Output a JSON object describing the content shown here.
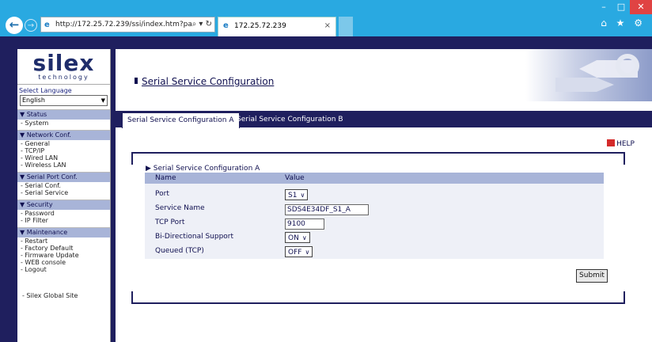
{
  "browser": {
    "url": "http://172.25.72.239/ssi/index.htm?pa",
    "tab_title": "172.25.72.239",
    "tab_close": "×",
    "window_controls": [
      "–",
      "□",
      "✕"
    ],
    "right_icons": "⌂ ★ ⚙"
  },
  "sidebar": {
    "logo_main": "silex",
    "logo_sub": "technology",
    "select_language_label": "Select Language",
    "language_value": "English",
    "groups": [
      {
        "head": "▼ Status",
        "items": [
          "- System"
        ]
      },
      {
        "head": "▼ Network Conf.",
        "items": [
          "- General",
          "- TCP/IP",
          "- Wired LAN",
          "- Wireless LAN"
        ]
      },
      {
        "head": "▼ Serial Port Conf.",
        "items": [
          "- Serial Conf.",
          "- Serial Service"
        ]
      },
      {
        "head": "▼ Security",
        "items": [
          "- Password",
          "- IP Filter"
        ]
      },
      {
        "head": "▼ Maintenance",
        "items": [
          "- Restart",
          "- Factory Default",
          "- Firmware Update",
          "- WEB console",
          "- Logout"
        ]
      }
    ],
    "global_site": "- Silex Global Site"
  },
  "main": {
    "title": "Serial Service Configuration",
    "tabs": [
      "Serial Service Configuration A",
      "Serial Service Configuration B"
    ],
    "help": "HELP",
    "section_title": "▶ Serial Service Configuration A",
    "table": {
      "headers": [
        "Name",
        "Value"
      ],
      "rows": [
        {
          "label": "Port",
          "value": "S1"
        },
        {
          "label": "Service Name",
          "value": "SDS4E34DF_S1_A"
        },
        {
          "label": "TCP Port",
          "value": "9100"
        },
        {
          "label": "Bi-Directional Support",
          "value": "ON"
        },
        {
          "label": "Queued (TCP)",
          "value": "OFF"
        }
      ]
    },
    "submit_label": "Submit"
  }
}
